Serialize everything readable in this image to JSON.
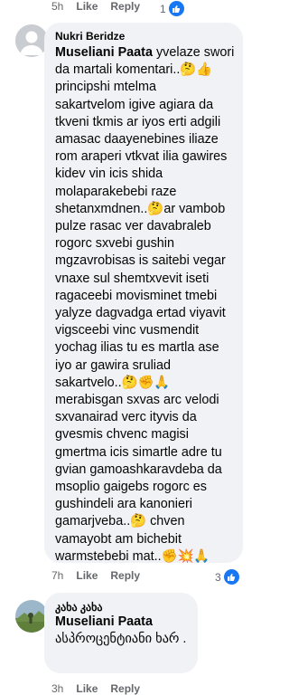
{
  "top_meta": {
    "time": "5h",
    "like": "Like",
    "reply": "Reply",
    "count": "1"
  },
  "comment1": {
    "author": "Nukri Beridze",
    "mention": "Museliani Paata",
    "text_lines": [
      " yvelaze swori",
      "da martali komentari..🤔👍",
      "principshi mtelma",
      "sakartvelom igive agiara da",
      "tkveni tkmis ar iyos erti adgili",
      "amasac daayenebines iliaze",
      "rom araperi vtkvat ilia gawires",
      "kidev vin icis shida",
      "molaparakebebi raze",
      "shetanxmdnen..🤔ar vambob",
      "pulze rasac ver davabraleb",
      "rogorc sxvebi gushin",
      "mgzavrobisas is saitebi vegar",
      "vnaxe sul shemtxvevit iseti",
      "ragaceebi movisminet tmebi",
      "yalyze dagvadga ertad viyavit",
      "vigsceebi vinc vusmendit",
      "yochag ilias tu es martla ase",
      "iyo ar gawira sruliad",
      "sakartvelo..🤔✊🙏",
      "merabisgan sxvas arc velodi",
      "sxvanairad verc ityvis da",
      "gvesmis chvenc magisi",
      "gmertma icis simartle adre tu",
      "gvian gamoashkaravdeba da",
      "msoplio gaigebs rogorc es",
      "gushindeli ara kanonieri",
      "gamarjveba..🤔 chven",
      "vamayobt am bichebit",
      "warmstebebi mat..✊💥🙏"
    ],
    "time": "7h",
    "like": "Like",
    "reply": "Reply",
    "count": "3"
  },
  "comment2": {
    "author": "კახა კახა",
    "mention": "Museliani Paata",
    "text": "ასპროცენტიანი ხარ .",
    "time": "3h",
    "like": "Like",
    "reply": "Reply"
  },
  "colors": {
    "like_blue": "#1877f2",
    "bubble": "#f0f2f5",
    "meta": "#65676b"
  }
}
